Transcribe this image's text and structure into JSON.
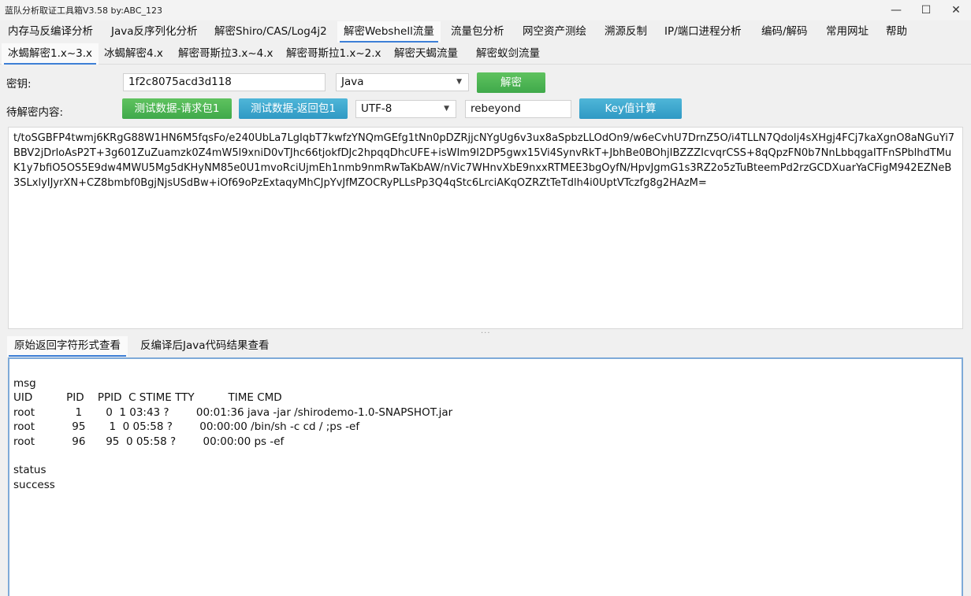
{
  "window": {
    "title": "蓝队分析取证工具箱V3.58 by:ABC_123",
    "min_glyph": "—",
    "max_glyph": "☐",
    "close_glyph": "✕"
  },
  "main_tabs": [
    {
      "label": "内存马反编译分析"
    },
    {
      "label": "Java反序列化分析"
    },
    {
      "label": "解密Shiro/CAS/Log4j2"
    },
    {
      "label": "解密Webshell流量"
    },
    {
      "label": "流量包分析"
    },
    {
      "label": "网空资产测绘"
    },
    {
      "label": "溯源反制"
    },
    {
      "label": "IP/端口进程分析"
    },
    {
      "label": "编码/解码"
    },
    {
      "label": "常用网址"
    },
    {
      "label": "帮助"
    }
  ],
  "sub_tabs": [
    {
      "label": "冰蝎解密1.x~3.x"
    },
    {
      "label": "冰蝎解密4.x"
    },
    {
      "label": "解密哥斯拉3.x~4.x"
    },
    {
      "label": "解密哥斯拉1.x~2.x"
    },
    {
      "label": "解密天蝎流量"
    },
    {
      "label": "解密蚁剑流量"
    }
  ],
  "form": {
    "key_label": "密钥:",
    "key_value": "1f2c8075acd3d118",
    "lang_value": "Java",
    "decrypt_button": "解密",
    "content_label": "待解密内容:",
    "test_request_button": "测试数据-请求包1",
    "test_response_button": "测试数据-返回包1",
    "encoding_value": "UTF-8",
    "password_value": "rebeyond",
    "key_calc_button": "Key值计算"
  },
  "cipher_text": "t/toSGBFP4twmj6KRgG88W1HN6M5fqsFo/e240UbLa7LgIqbT7kwfzYNQmGEfg1tNn0pDZRjjcNYgUg6v3ux8aSpbzLLOdOn9/w6eCvhU7DrnZ5O/i4TLLN7QdoIj4sXHgj4FCj7kaXgnO8aNGuYi7BBV2jDrloAsP2T+3g601ZuZuamzk0Z4mW5l9xniD0vTJhc66tjokfDJc2hpqqDhcUFE+isWIm9I2DP5gwx15Vi4SynvRkT+JbhBe0BOhjIBZZZIcvqrCSS+8qQpzFN0b7NnLbbqgaITFnSPblhdTMuK1y7bfiO5OS5E9dw4MWU5Mg5dKHyNM85e0U1mvoRciUjmEh1nmb9nmRwTaKbAW/nVic7WHnvXbE9nxxRTMEE3bgOyfN/HpvJgmG1s3RZ2o5zTuBteemPd2rzGCDXuarYaCFigM942EZNeB3SLxlyIJyrXN+CZ8bmbf0BgjNjsUSdBw+iOf69oPzExtaqyMhCJpYvJfMZOCRyPLLsPp3Q4qStc6LrciAKqOZRZtTeTdlh4i0UptVTczfg8g2HAzM=",
  "result_tabs": [
    {
      "label": "原始返回字符形式查看"
    },
    {
      "label": "反编译后Java代码结果查看"
    }
  ],
  "result_lines": [
    "msg",
    "UID          PID    PPID  C STIME TTY          TIME CMD",
    "root            1       0  1 03:43 ?        00:01:36 java -jar /shirodemo-1.0-SNAPSHOT.jar",
    "root           95       1  0 05:58 ?        00:00:00 /bin/sh -c cd / ;ps -ef",
    "root           96      95  0 05:58 ?        00:00:00 ps -ef",
    "",
    "status",
    "success"
  ],
  "colors": {
    "green_button": "#4bb352",
    "blue_button": "#38a6cf",
    "tab_underline": "#3d7fd6"
  }
}
